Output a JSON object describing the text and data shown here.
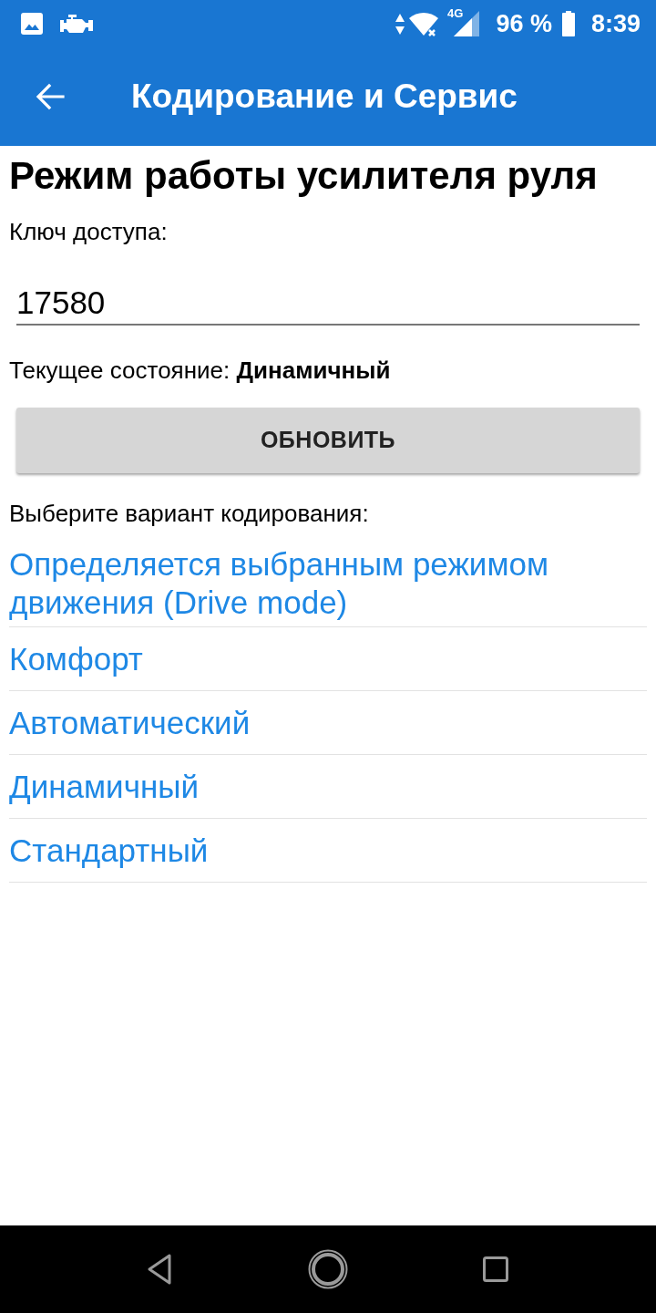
{
  "status_bar": {
    "network": "4G",
    "battery": "96 %",
    "time": "8:39"
  },
  "app_bar": {
    "title": "Кодирование и Сервис"
  },
  "screen": {
    "heading": "Режим работы усилителя руля",
    "access_key": {
      "label": "Ключ доступа:",
      "value": "17580"
    },
    "current_state": "Текущее состояние: **Динамичный**",
    "refresh_button": "ОБНОВИТЬ",
    "options_label": "Выберите вариант кодирования:",
    "options": [
      {
        "label": "Определяется выбранным режимом движения (Drive mode)"
      },
      {
        "label": "Комфорт"
      },
      {
        "label": "Автоматический"
      },
      {
        "label": "Динамичный"
      },
      {
        "label": "Стандартный"
      }
    ]
  }
}
